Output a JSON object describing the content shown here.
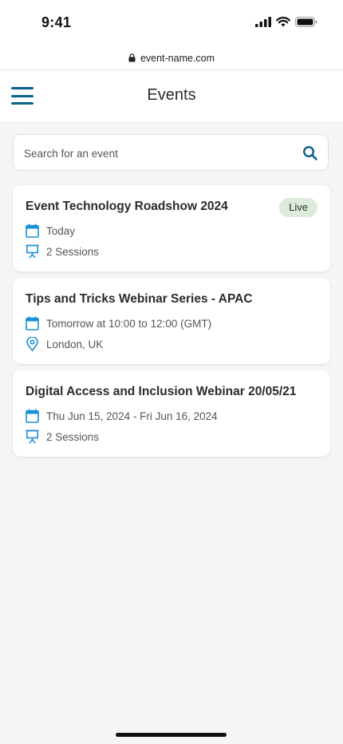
{
  "status_bar": {
    "time": "9:41"
  },
  "browser": {
    "url": "event-name.com"
  },
  "header": {
    "title": "Events"
  },
  "search": {
    "placeholder": "Search for an event",
    "value": ""
  },
  "colors": {
    "accent": "#0a5f8c",
    "icon_blue": "#1b8fd6",
    "live_badge_bg": "#dcebdc"
  },
  "events": [
    {
      "title": "Event Technology Roadshow 2024",
      "badge": "Live",
      "date": "Today",
      "detail": "2 Sessions",
      "detail_icon": "presentation-icon"
    },
    {
      "title": "Tips and Tricks Webinar Series - APAC",
      "badge": "",
      "date": "Tomorrow at 10:00 to 12:00 (GMT)",
      "detail": "London, UK",
      "detail_icon": "location-pin-icon"
    },
    {
      "title": "Digital Access and Inclusion Webinar 20/05/21",
      "badge": "",
      "date": "Thu Jun 15, 2024 - Fri Jun 16, 2024",
      "detail": "2 Sessions",
      "detail_icon": "presentation-icon"
    }
  ]
}
